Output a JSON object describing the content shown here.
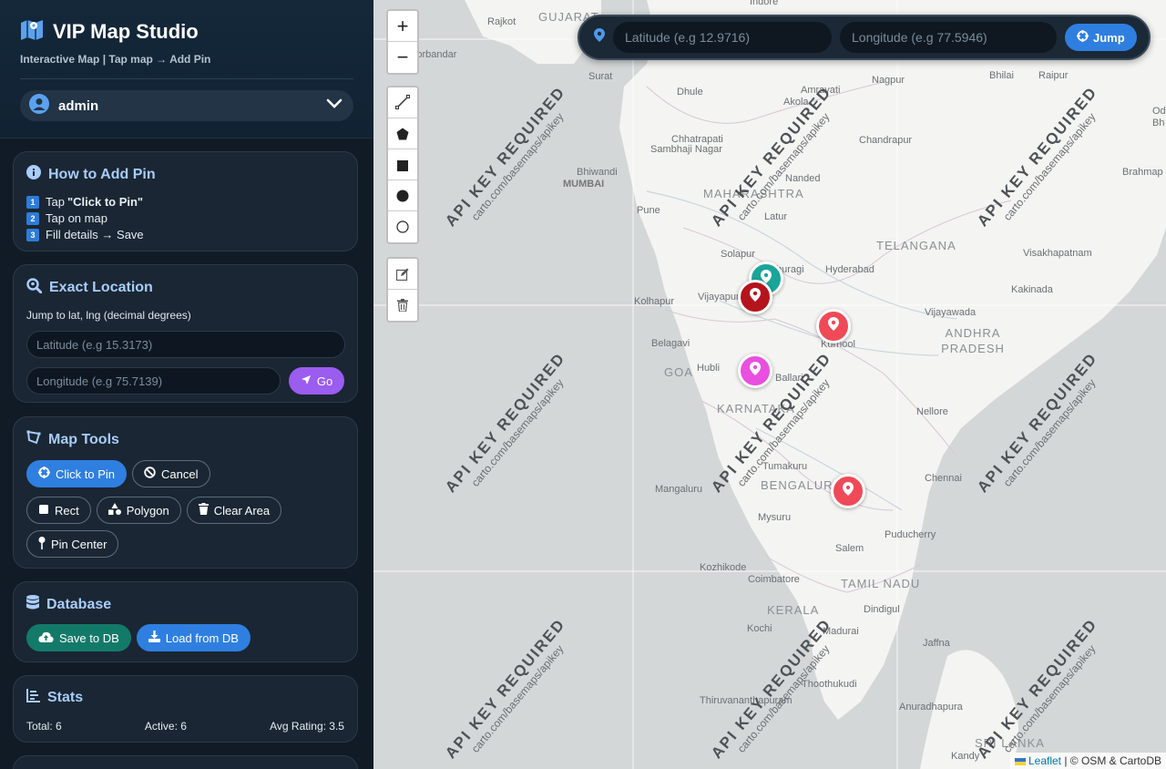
{
  "app": {
    "title": "VIP Map Studio",
    "subtitle": "Interactive Map | Tap map → Add Pin",
    "user": "admin"
  },
  "how_to": {
    "title": "How to Add Pin",
    "steps": [
      {
        "num": "1",
        "pre": "Tap ",
        "bold": "\"Click to Pin\""
      },
      {
        "num": "2",
        "pre": "Tap on map",
        "bold": ""
      },
      {
        "num": "3",
        "pre": "Fill details → Save",
        "bold": ""
      }
    ]
  },
  "exact_location": {
    "title": "Exact Location",
    "hint": "Jump to lat, lng (decimal degrees)",
    "lat_placeholder": "Latitude (e.g 15.3173)",
    "lng_placeholder": "Longitude (e.g 75.7139)",
    "go_label": "Go"
  },
  "map_tools": {
    "title": "Map Tools",
    "click_to_pin": "Click to Pin",
    "cancel": "Cancel",
    "rect": "Rect",
    "polygon": "Polygon",
    "clear_area": "Clear Area",
    "pin_center": "Pin Center"
  },
  "database": {
    "title": "Database",
    "save": "Save to DB",
    "load": "Load from DB"
  },
  "stats": {
    "title": "Stats",
    "total": "Total: 6",
    "active": "Active: 6",
    "avg": "Avg Rating: 3.5"
  },
  "topbar": {
    "lat_placeholder": "Latitude (e.g 12.9716)",
    "lng_placeholder": "Longitude (e.g 77.5946)",
    "jump_label": "Jump"
  },
  "map": {
    "zoom_in": "+",
    "zoom_out": "−",
    "attribution_link": "Leaflet",
    "attribution_rest": " | © OSM & CartoDB",
    "watermark_main": "API KEY REQUIRED",
    "watermark_sub": "carto.com/basemaps/apikey",
    "states": [
      "GUJARAT",
      "MAHARASHTRA",
      "TELANGANA",
      "ANDHRA PRADESH",
      "GOA",
      "KARNATAKA",
      "BENGALURU",
      "TAMIL NADU",
      "KERALA",
      "SRI LANKA"
    ],
    "cities": [
      "Indore",
      "Rajkot",
      "Porbandar",
      "Surat",
      "Dhule",
      "Amravati",
      "Nagpur",
      "Bhilai",
      "Raipur",
      "Akola",
      "Chhatrapati",
      "Sambhaji Nagar",
      "Chandrapur",
      "Bhiwandi",
      "MUMBAI",
      "Nanded",
      "Pune",
      "Latur",
      "Solapur",
      "Kalaburagi",
      "Hyderabad",
      "Visakhapatnam",
      "Brahmap",
      "Kolhapur",
      "Vijayapura",
      "Kakinada",
      "Vijayawada",
      "Kurnool",
      "Belagavi",
      "Hubli",
      "Ballari",
      "Nellore",
      "Tumakuru",
      "Chennai",
      "Mangaluru",
      "Mysuru",
      "Puducherry",
      "Salem",
      "Kozhikode",
      "Coimbatore",
      "Dindigul",
      "Kochi",
      "Madurai",
      "Jaffna",
      "Thoothukudi",
      "Thiruvananthapuram",
      "Anuradhapura",
      "Kandy",
      "Od",
      "Bh"
    ]
  },
  "colors": {
    "accent_blue": "#2f7fe0",
    "accent_purple": "#9b5cf0",
    "accent_teal": "#137a6a",
    "pin_red": "#f04a58",
    "pin_darkred": "#b5141c",
    "pin_teal": "#1aa59a",
    "pin_magenta": "#e94fe0"
  }
}
